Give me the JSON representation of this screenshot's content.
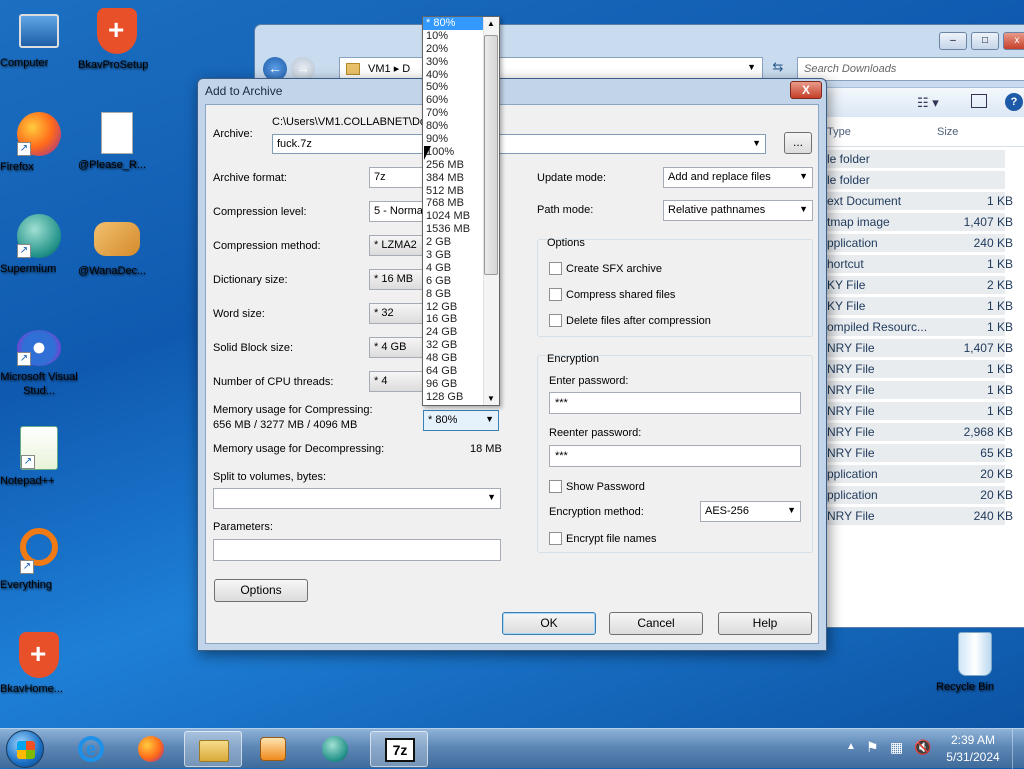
{
  "desktop": {
    "icons": [
      {
        "label": "Computer"
      },
      {
        "label": "BkavProSetup"
      },
      {
        "label": "Firefox"
      },
      {
        "label": "@Please_R..."
      },
      {
        "label": "Supermium"
      },
      {
        "label": "@WanaDec..."
      },
      {
        "label": "Microsoft Visual Stud..."
      },
      {
        "label": "Notepad++"
      },
      {
        "label": "Everything"
      },
      {
        "label": "BkavHome..."
      },
      {
        "label": "Recycle Bin"
      }
    ]
  },
  "explorer": {
    "address_segments": [
      "VM1",
      "D"
    ],
    "search_placeholder": "Search Downloads",
    "columns": {
      "type": "Type",
      "size": "Size"
    },
    "rows": [
      {
        "type": "le folder",
        "size": ""
      },
      {
        "type": "le folder",
        "size": ""
      },
      {
        "type": "ext Document",
        "size": "1 KB"
      },
      {
        "type": "tmap image",
        "size": "1,407 KB"
      },
      {
        "type": "pplication",
        "size": "240 KB"
      },
      {
        "type": "hortcut",
        "size": "1 KB"
      },
      {
        "type": "KY File",
        "size": "2 KB"
      },
      {
        "type": "KY File",
        "size": "1 KB"
      },
      {
        "type": "ompiled Resourc...",
        "size": "1 KB"
      },
      {
        "type": "NRY File",
        "size": "1,407 KB"
      },
      {
        "type": "NRY File",
        "size": "1 KB"
      },
      {
        "type": "NRY File",
        "size": "1 KB"
      },
      {
        "type": "NRY File",
        "size": "1 KB"
      },
      {
        "type": "NRY File",
        "size": "2,968 KB"
      },
      {
        "type": "NRY File",
        "size": "65 KB"
      },
      {
        "type": "pplication",
        "size": "20 KB"
      },
      {
        "type": "pplication",
        "size": "20 KB"
      },
      {
        "type": "NRY File",
        "size": "240 KB"
      }
    ]
  },
  "dialog": {
    "title": "Add to Archive",
    "close_glyph": "X",
    "archive_label": "Archive:",
    "archive_path": "C:\\Users\\VM1.COLLABNET\\Do",
    "archive_name": "fuck.7z",
    "browse_label": "...",
    "fields": {
      "archive_format": {
        "label": "Archive format:",
        "value": "7z"
      },
      "compression_level": {
        "label": "Compression level:",
        "value": "5 - Normal"
      },
      "compression_method": {
        "label": "Compression method:",
        "value": "LZMA2"
      },
      "dictionary_size": {
        "label": "Dictionary size:",
        "value": "16 MB"
      },
      "word_size": {
        "label": "Word size:",
        "value": "32"
      },
      "solid_block_size": {
        "label": "Solid Block size:",
        "value": "4 GB"
      },
      "cpu_threads": {
        "label": "Number of CPU threads:",
        "value": "4"
      }
    },
    "memory_compress_label": "Memory usage for Compressing:",
    "memory_compress_value": "656 MB / 3277 MB / 4096 MB",
    "memory_compress_selected": "80%",
    "memory_decompress_label": "Memory usage for Decompressing:",
    "memory_decompress_value": "18 MB",
    "split_label": "Split to volumes, bytes:",
    "split_value": "",
    "parameters_label": "Parameters:",
    "parameters_value": "",
    "options_button": "Options",
    "update_mode": {
      "label": "Update mode:",
      "value": "Add and replace files"
    },
    "path_mode": {
      "label": "Path mode:",
      "value": "Relative pathnames"
    },
    "options_group": {
      "title": "Options",
      "items": [
        "Create SFX archive",
        "Compress shared files",
        "Delete files after compression"
      ]
    },
    "encryption_group": {
      "title": "Encryption",
      "enter_password_label": "Enter password:",
      "enter_password_value": "***",
      "reenter_password_label": "Reenter password:",
      "reenter_password_value": "***",
      "show_password_label": "Show Password",
      "method_label": "Encryption method:",
      "method_value": "AES-256",
      "encrypt_names_label": "Encrypt file names"
    },
    "buttons": {
      "ok": "OK",
      "cancel": "Cancel",
      "help": "Help"
    }
  },
  "dropdown": {
    "selected_index": 0,
    "items": [
      "* 80%",
      "10%",
      "20%",
      "30%",
      "40%",
      "50%",
      "60%",
      "70%",
      "80%",
      "90%",
      "100%",
      "256 MB",
      "384 MB",
      "512 MB",
      "768 MB",
      "1024 MB",
      "1536 MB",
      "2 GB",
      "3 GB",
      "4 GB",
      "6 GB",
      "8 GB",
      "12 GB",
      "16 GB",
      "24 GB",
      "32 GB",
      "48 GB",
      "64 GB",
      "96 GB",
      "128 GB"
    ]
  },
  "taskbar": {
    "clock_time": "2:39 AM",
    "clock_date": "5/31/2024",
    "active_app_label": "7z"
  }
}
